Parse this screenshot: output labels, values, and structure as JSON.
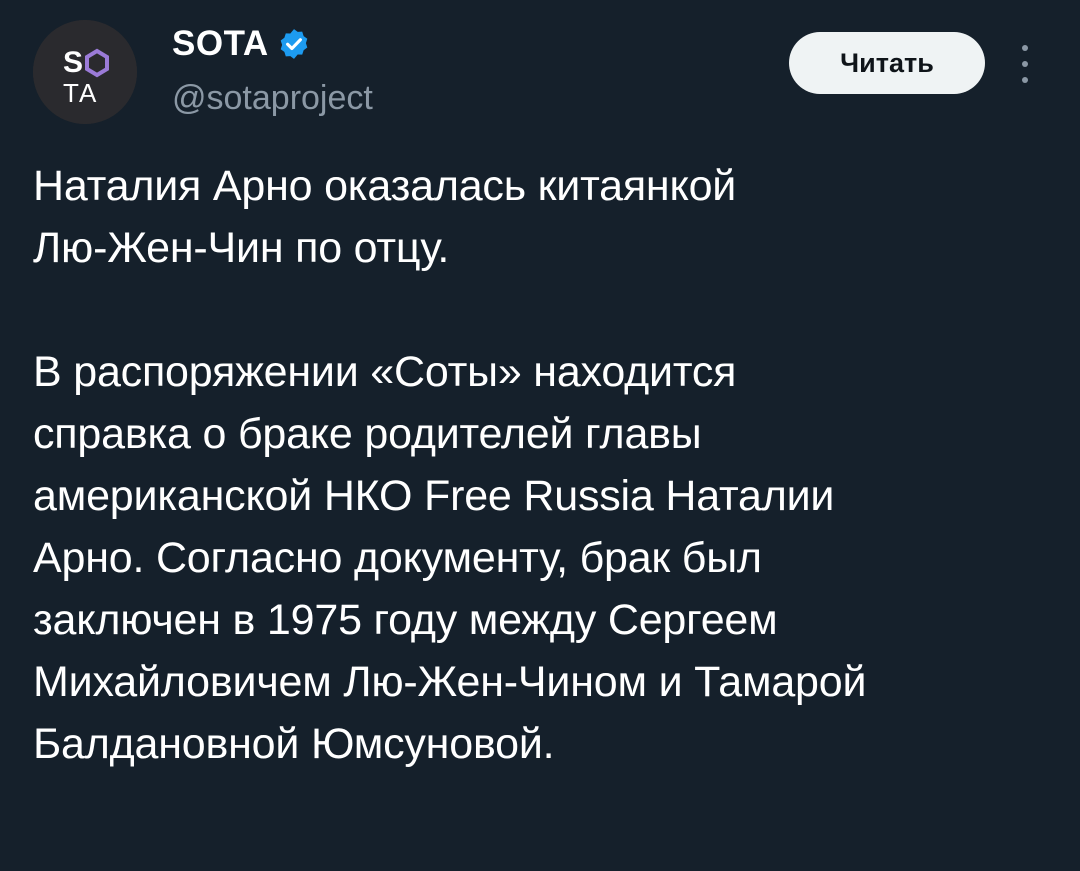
{
  "author": {
    "avatar_text_top": "SO",
    "avatar_text_bottom": "TA",
    "name": "SOTA",
    "handle": "@sotaproject",
    "verified_icon": "verified-badge-icon",
    "verified_color": "#1d9bf0"
  },
  "actions": {
    "follow_label": "Читать",
    "more_icon": "more-vertical-icon"
  },
  "tweet": {
    "paragraph1_line1": "Наталия Арно оказалась китаянкой",
    "paragraph1_line2": "Лю-Жен-Чин по отцу.",
    "paragraph2_line1": "В распоряжении «Соты» находится",
    "paragraph2_line2": "справка о браке родителей главы",
    "paragraph2_line3": "американской НКО Free Russia Наталии",
    "paragraph2_line4": "Арно. Согласно документу, брак был",
    "paragraph2_line5": "заключен в 1975 году между Сергеем",
    "paragraph2_line6": "Михайловичем Лю-Жен-Чином и Тамарой",
    "paragraph2_line7": "Балдановной Юмсуновой."
  },
  "colors": {
    "background": "#15202b",
    "secondary_text": "#8b98a5",
    "avatar_accent": "#9b7bd8"
  }
}
